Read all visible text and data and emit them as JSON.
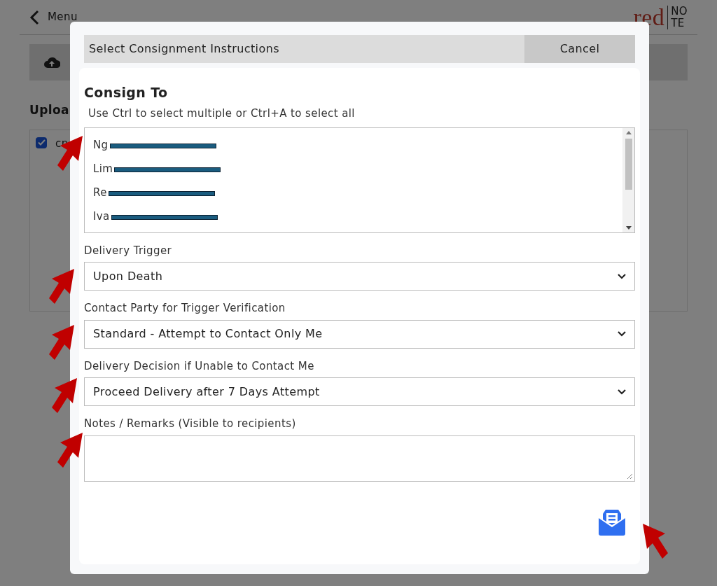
{
  "page": {
    "back_label": "Menu",
    "logo": {
      "left": "red",
      "top": "NO",
      "bottom": "TE"
    },
    "section_heading": "Uploa",
    "file": {
      "name": "cn",
      "checked": true
    }
  },
  "dialog": {
    "title": "Select Consignment Instructions",
    "cancel": "Cancel",
    "consign_to": {
      "heading": "Consign To",
      "hint": "Use Ctrl to select multiple or Ctrl+A to select all",
      "recipients": [
        {
          "name": "Ng",
          "redacted": true
        },
        {
          "name": "Lim",
          "redacted": true
        },
        {
          "name": "Re",
          "redacted": true
        },
        {
          "name": "Iva",
          "redacted": true
        }
      ]
    },
    "fields": [
      {
        "kind": "select",
        "label": "Delivery Trigger",
        "value": "Upon Death"
      },
      {
        "kind": "select",
        "label": "Contact Party for Trigger Verification",
        "value": "Standard - Attempt to Contact Only Me"
      },
      {
        "kind": "select",
        "label": "Delivery Decision if Unable to Contact Me",
        "value": "Proceed Delivery after 7 Days Attempt"
      },
      {
        "kind": "textarea",
        "label": "Notes / Remarks (Visible to recipients)"
      }
    ]
  },
  "annotations": [
    {
      "kind": "arrow"
    },
    {
      "kind": "arrow"
    },
    {
      "kind": "arrow"
    },
    {
      "kind": "arrow"
    },
    {
      "kind": "arrow"
    },
    {
      "kind": "arrow"
    }
  ]
}
